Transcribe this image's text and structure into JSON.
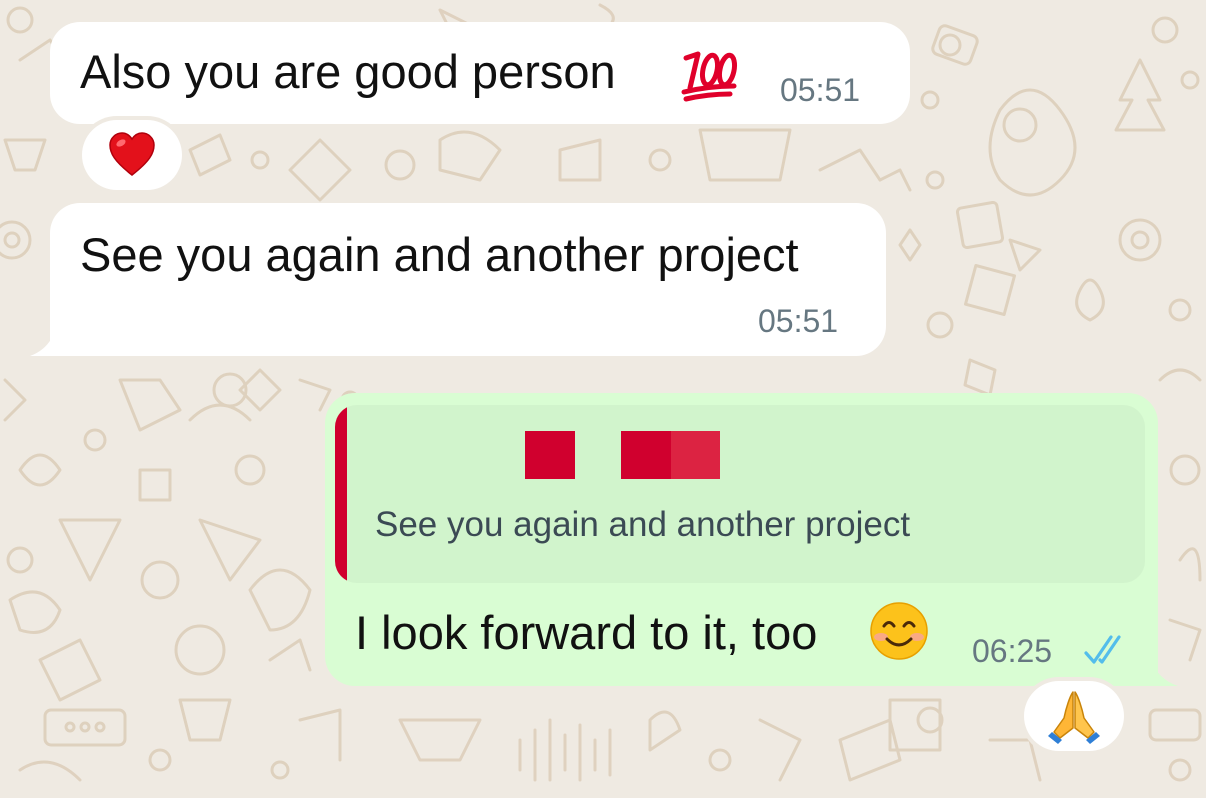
{
  "colors": {
    "wallpaper": "#efeae2",
    "incoming_bubble": "#ffffff",
    "outgoing_bubble": "#d9fdd3",
    "quote_background": "#d1f4cc",
    "quote_accent": "#d0002e",
    "read_receipt": "#53bdeb",
    "time_text": "#667781"
  },
  "messages": [
    {
      "direction": "incoming",
      "text": "Also you are good person",
      "emoji_icon": "hundred-points-icon",
      "time": "05:51",
      "reaction_icon": "red-heart-icon"
    },
    {
      "direction": "incoming",
      "text": "See you again and another project",
      "time": "05:51"
    },
    {
      "direction": "outgoing",
      "quoted_text": "See you again and another project",
      "quoted_sender": "redacted",
      "text": "I look forward to it, too",
      "emoji_icon": "smiling-face-icon",
      "time": "06:25",
      "status_icon": "double-check-read-icon",
      "reaction_icon": "folded-hands-icon"
    }
  ]
}
